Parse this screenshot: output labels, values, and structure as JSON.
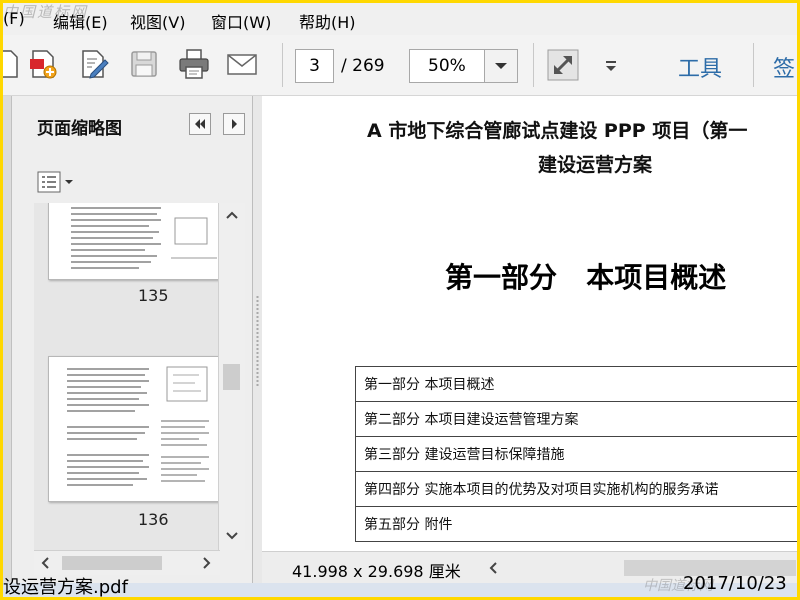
{
  "watermark": "中国道标网",
  "menu": {
    "items": [
      "(F)",
      "编辑(E)",
      "视图(V)",
      "窗口(W)",
      "帮助(H)"
    ]
  },
  "toolbar": {
    "current_page": "3",
    "total_pages": "/ 269",
    "zoom": "50%",
    "tools_label": "工具",
    "sign_label": "签",
    "icons": [
      "document-icon",
      "create-pdf-icon",
      "edit-icon",
      "save-icon",
      "print-icon",
      "email-icon",
      "fullscreen-icon",
      "more-icon"
    ]
  },
  "panel": {
    "title": "页面缩略图",
    "thumbnails": [
      {
        "label": "135"
      },
      {
        "label": "136"
      }
    ]
  },
  "document": {
    "title": "A 市地下综合管廊试点建设 PPP 项目（第一",
    "subtitle": "建设运营方案",
    "heading": "第一部分   本项目概述",
    "toc": [
      "第一部分  本项目概述",
      "第二部分  本项目建设运营管理方案",
      "第三部分  建设运营目标保障措施",
      "第四部分  实施本项目的优势及对项目实施机构的服务承诺",
      "第五部分  附件"
    ]
  },
  "status": {
    "page_size": "41.998 x 29.698 厘米"
  },
  "taskbar": {
    "filename": "设运营方案.pdf",
    "date": "2017/10/23"
  },
  "colors": {
    "border": "#ffd800",
    "accent": "#2d6ca8"
  }
}
